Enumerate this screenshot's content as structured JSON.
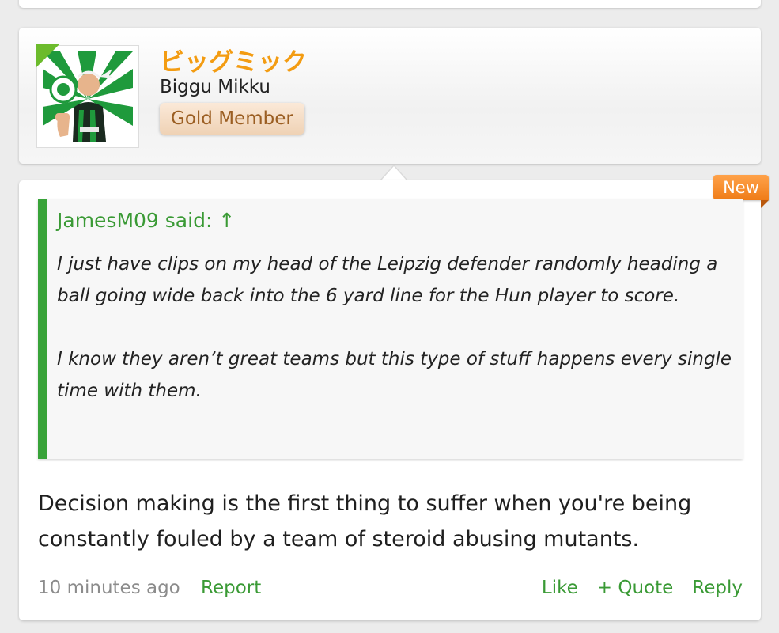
{
  "user": {
    "name": "ビッグミック",
    "title": "Biggu Mikku",
    "badge": "Gold Member",
    "avatar_icon": "footballer-avatar",
    "online_color": "#6cbb2c"
  },
  "post": {
    "new_badge": "New",
    "quote": {
      "header": "JamesM09 said: ↑",
      "paragraphs": [
        "I just have clips on my head of the Leipzig defender randomly heading a ball going wide back into the 6 yard line for the Hun player to score.",
        "I know they aren’t great teams but this type of stuff happens every single time with them."
      ]
    },
    "message": "Decision making is the first thing to suffer when you're being constantly fouled by a team of steroid abusing mutants.",
    "timestamp": "10 minutes ago",
    "report_label": "Report",
    "actions": {
      "like": "Like",
      "quote": "+ Quote",
      "reply": "Reply"
    }
  },
  "colors": {
    "accent": "#3a9a35",
    "username": "#f39c12",
    "new_badge": "#ef7c17"
  }
}
